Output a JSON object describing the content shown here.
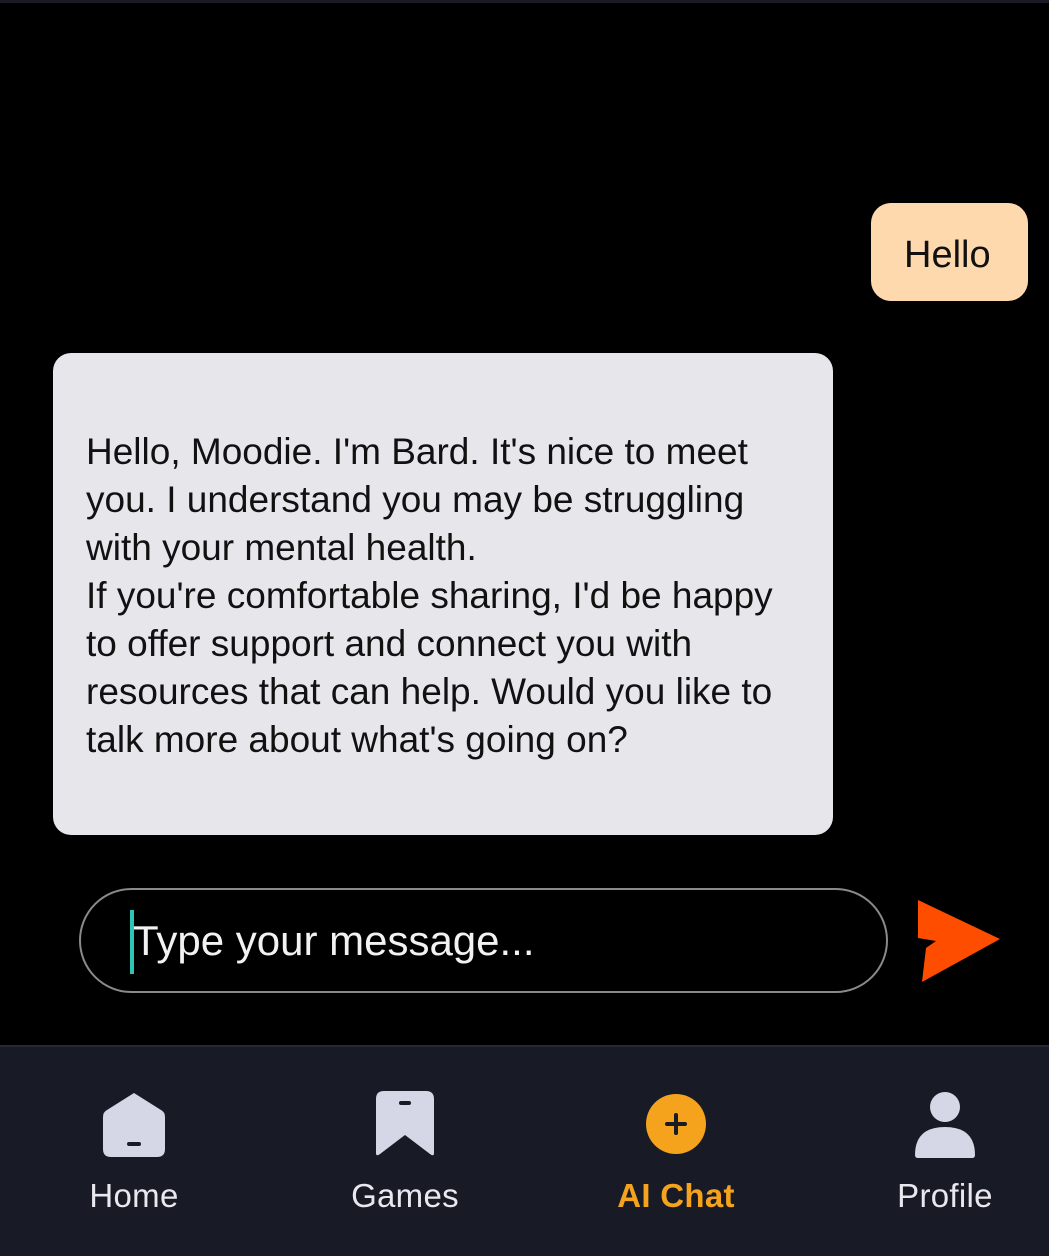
{
  "chat": {
    "user_message": "Hello",
    "bot_message": "Hello, Moodie. I'm Bard. It's nice to meet you. I understand you may be struggling with your mental health.\nIf you're comfortable sharing, I'd be happy to offer support and connect you with resources that can help. Would you like to talk more about what's going on?"
  },
  "composer": {
    "placeholder": "Type your message...",
    "value": "",
    "send_icon": "send-arrow-icon"
  },
  "nav": {
    "items": [
      {
        "label": "Home",
        "icon": "home-icon",
        "active": false
      },
      {
        "label": "Games",
        "icon": "games-icon",
        "active": false
      },
      {
        "label": "AI Chat",
        "icon": "add-chat-icon",
        "active": true
      },
      {
        "label": "Profile",
        "icon": "profile-icon",
        "active": false
      }
    ]
  },
  "colors": {
    "background": "#000000",
    "user_bubble": "#ffd9ae",
    "bot_bubble": "#e6e6eb",
    "accent": "#f5a31d",
    "send": "#ff4d00",
    "nav_background": "#181a25",
    "icon_fill": "#d5d7e6"
  }
}
